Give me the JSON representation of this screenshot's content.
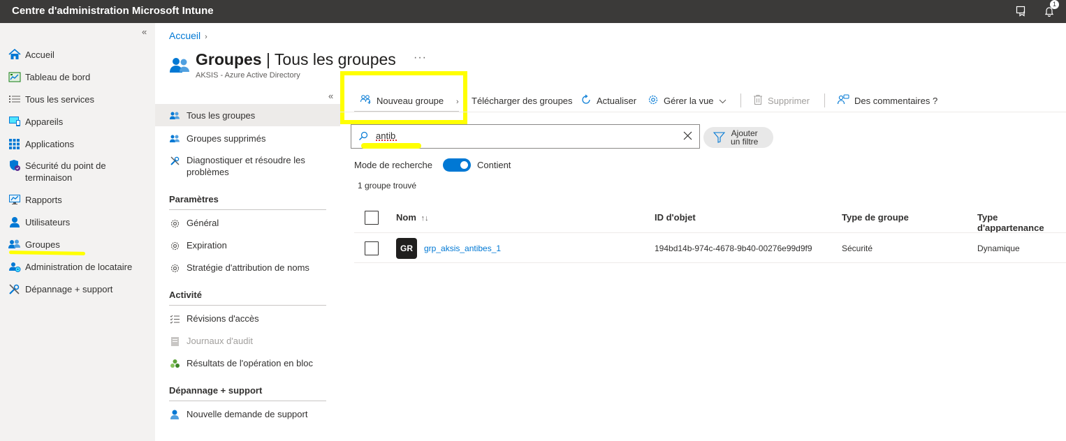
{
  "app": {
    "title": "Centre d'administration Microsoft Intune",
    "notification_count": "1"
  },
  "nav": {
    "collapse": "«",
    "items": [
      {
        "label": "Accueil",
        "icon": "home-icon"
      },
      {
        "label": "Tableau de bord",
        "icon": "dashboard-icon"
      },
      {
        "label": "Tous les services",
        "icon": "list-icon"
      },
      {
        "label": "Appareils",
        "icon": "devices-icon"
      },
      {
        "label": "Applications",
        "icon": "apps-grid-icon"
      },
      {
        "label": "Sécurité du point de terminaison",
        "icon": "shield-icon"
      },
      {
        "label": "Rapports",
        "icon": "reports-icon"
      },
      {
        "label": "Utilisateurs",
        "icon": "user-icon"
      },
      {
        "label": "Groupes",
        "icon": "groups-icon"
      },
      {
        "label": "Administration de locataire",
        "icon": "tenant-admin-icon"
      },
      {
        "label": "Dépannage + support",
        "icon": "tools-icon"
      }
    ]
  },
  "breadcrumb": {
    "home": "Accueil",
    "sep": "›"
  },
  "page": {
    "title_bold": "Groupes",
    "title_rest": " | Tous les groupes",
    "more": "···",
    "subtitle": "AKSIS - Azure Active Directory"
  },
  "submenu": {
    "collapse": "«",
    "items": {
      "all_groups": "Tous les groupes",
      "deleted_groups": "Groupes supprimés",
      "diagnose": "Diagnostiquer et résoudre les problèmes"
    },
    "sections": {
      "settings": {
        "title": "Paramètres",
        "items": [
          "Général",
          "Expiration",
          "Stratégie d'attribution de noms"
        ]
      },
      "activity": {
        "title": "Activité",
        "items": [
          "Révisions d'accès",
          "Journaux d'audit",
          "Résultats de l'opération en bloc"
        ]
      },
      "support": {
        "title": "Dépannage + support",
        "items": [
          "Nouvelle demande de support"
        ]
      }
    }
  },
  "toolbar": {
    "new_group": "Nouveau groupe",
    "download": "Télécharger des groupes",
    "refresh": "Actualiser",
    "manage_view": "Gérer la vue",
    "delete": "Supprimer",
    "feedback": "Des commentaires ?"
  },
  "search": {
    "value": "antib"
  },
  "filter": {
    "label_line1": "Ajouter",
    "label_line2": "un filtre"
  },
  "search_mode": {
    "label": "Mode de recherche",
    "value": "Contient",
    "enabled": true
  },
  "results": {
    "count_text": "1 groupe trouvé"
  },
  "table": {
    "columns": [
      "Nom",
      "ID d'objet",
      "Type de groupe",
      "Type d'appartenance"
    ],
    "sort_glyph": "↑↓",
    "rows": [
      {
        "initials": "GR",
        "name": "grp_aksis_antibes_1",
        "object_id": "194bd14b-974c-4678-9b40-00276e99d9f9",
        "group_type": "Sécurité",
        "membership_type": "Dynamique"
      }
    ]
  },
  "colors": {
    "accent": "#0078d4",
    "topbar": "#3b3a39",
    "highlight": "#ffff00"
  }
}
